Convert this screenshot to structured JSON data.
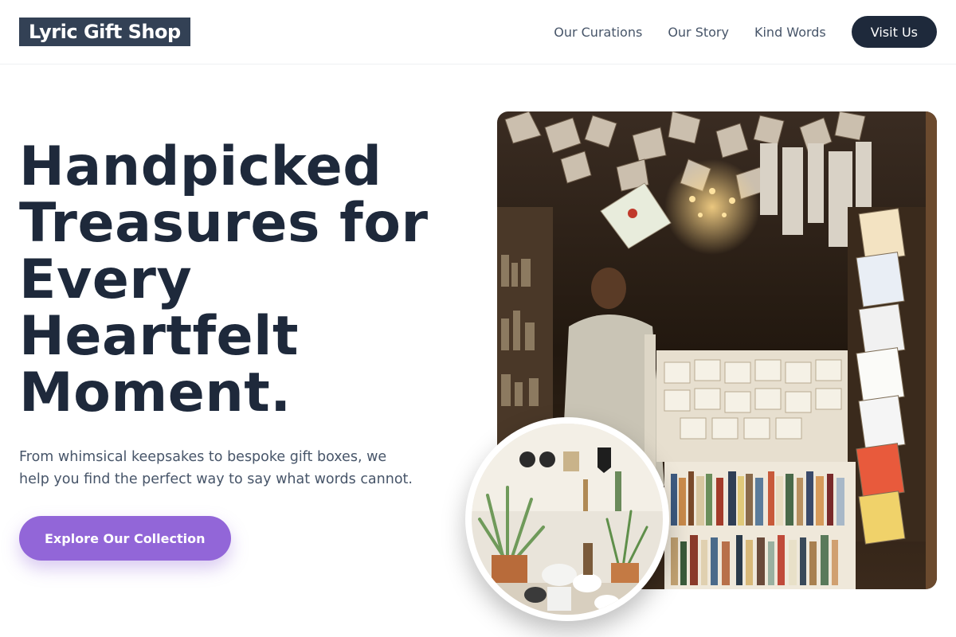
{
  "header": {
    "logo": "Lyric Gift Shop",
    "nav": [
      "Our Curations",
      "Our Story",
      "Kind Words"
    ],
    "visit_button": "Visit Us"
  },
  "hero": {
    "headline_lines": [
      "Handpicked",
      "Treasures for",
      "Every",
      "Heartfelt",
      "Moment."
    ],
    "subtext_lines": [
      "From whimsical keepsakes to bespoke gift boxes, we",
      "help you find the perfect way to say what words cannot."
    ],
    "cta": "Explore Our Collection"
  },
  "colors": {
    "brand_dark": "#1e293b",
    "logo_bg": "#334155",
    "accent_purple": "#9266d8",
    "text_muted": "#475569"
  }
}
